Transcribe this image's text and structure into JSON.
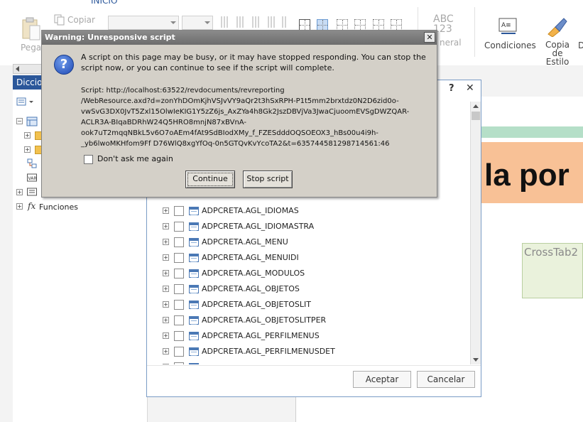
{
  "ribbon": {
    "tab_inicio": "INICIO",
    "copy_label": "Copiar",
    "paste_label": "Pega",
    "format_label": "ABC\n123",
    "format_sub": "neral",
    "conditions_label": "Condiciones",
    "copy_style_label": "Copia\nde\nEstilo",
    "partial_d": "D"
  },
  "left_panel": {
    "title": "Diccio",
    "functions_label": "Funciones"
  },
  "canvas": {
    "title_fragment": "la por",
    "crosstab_label": "CrossTab2"
  },
  "table_dialog": {
    "help": "?",
    "close": "✕",
    "tables": [
      "ADPCRETA.AGL_IDIOMAS",
      "ADPCRETA.AGL_IDIOMASTRA",
      "ADPCRETA.AGL_MENU",
      "ADPCRETA.AGL_MENUIDI",
      "ADPCRETA.AGL_MODULOS",
      "ADPCRETA.AGL_OBJETOS",
      "ADPCRETA.AGL_OBJETOSLIT",
      "ADPCRETA.AGL_OBJETOSLITPER",
      "ADPCRETA.AGL_PERFILMENUS",
      "ADPCRETA.AGL_PERFILMENUSDET"
    ],
    "accept_label": "Aceptar",
    "cancel_label": "Cancelar"
  },
  "warning": {
    "title": "Warning: Unresponsive script",
    "close": "✕",
    "icon_glyph": "?",
    "message": "A script on this page may be busy, or it may have stopped responding. You can stop the script now, or you can continue to see if the script will complete.",
    "script_lines": [
      "Script: http://localhost:63522/revdocuments/revreporting",
      "/WebResource.axd?d=zonYhDOmKjhVSJvVY9aQr2t3hSxRPH-P1t5mm2brxtdz0N2D6zid0o-",
      "vwSvG3DX0JvT5Zxl15OlwIeKIG1Y5zZ6js_AxZYa4h8Gk2JszDBVjVa3JwaCjuoomEVSgDWZQAR-",
      "ACLR3A-BIqaBDRhW24Q5HRO8mnjN87xBVnA-",
      "ook7uT2mqqNBkL5v6O7oAEm4fAt9SdBIodXMy_f_FZESdddOQSOEOX3_hBs00u4i9h-",
      "_yb6lwoMKHfom9Ff D76WlQ8xgYfOq-0n5GTQvKvYcoTA2&t=635744581298714561:46"
    ],
    "dont_ask_label": "Don't ask me again",
    "continue_label": "Continue",
    "stop_label": "Stop script"
  }
}
